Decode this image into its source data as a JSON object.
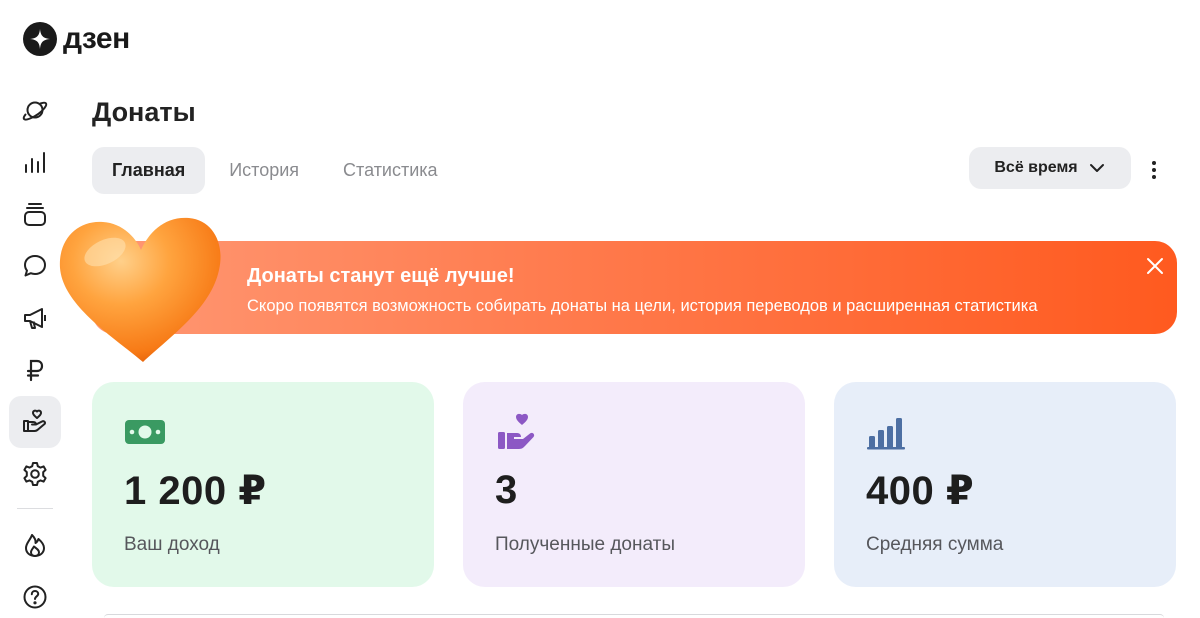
{
  "logo": {
    "text": "дзен"
  },
  "sidebar": {
    "items": [
      {
        "name": "planet-icon"
      },
      {
        "name": "bar-chart-icon"
      },
      {
        "name": "stack-icon"
      },
      {
        "name": "chat-icon"
      },
      {
        "name": "megaphone-icon"
      },
      {
        "name": "ruble-icon"
      },
      {
        "name": "donate-hand-heart-icon",
        "active": true
      },
      {
        "name": "gear-icon"
      },
      {
        "name": "fire-icon"
      },
      {
        "name": "help-icon"
      }
    ]
  },
  "page": {
    "title": "Донаты"
  },
  "tabs": [
    {
      "label": "Главная",
      "active": true
    },
    {
      "label": "История",
      "active": false
    },
    {
      "label": "Статистика",
      "active": false
    }
  ],
  "period": {
    "selected": "Всё время"
  },
  "banner": {
    "title": "Донаты станут ещё лучше!",
    "text": "Скоро появятся возможность собирать донаты на цели, история переводов и расширенная статистика"
  },
  "stats": [
    {
      "value": "1 200 ₽",
      "label": "Ваш доход",
      "icon": "money-icon",
      "color": "#3a9a62"
    },
    {
      "value": "3",
      "label": "Полученные донаты",
      "icon": "hand-heart-icon",
      "color": "#8c58c4"
    },
    {
      "value": "400 ₽",
      "label": "Средняя сумма",
      "icon": "bar-chart-icon",
      "color": "#4d6fa3"
    }
  ],
  "colors": {
    "banner_start": "#ff9874",
    "banner_end": "#ff5a1f",
    "card_green": "#e2f9ea",
    "card_purple": "#f3ecfb",
    "card_blue": "#e7eef9"
  }
}
